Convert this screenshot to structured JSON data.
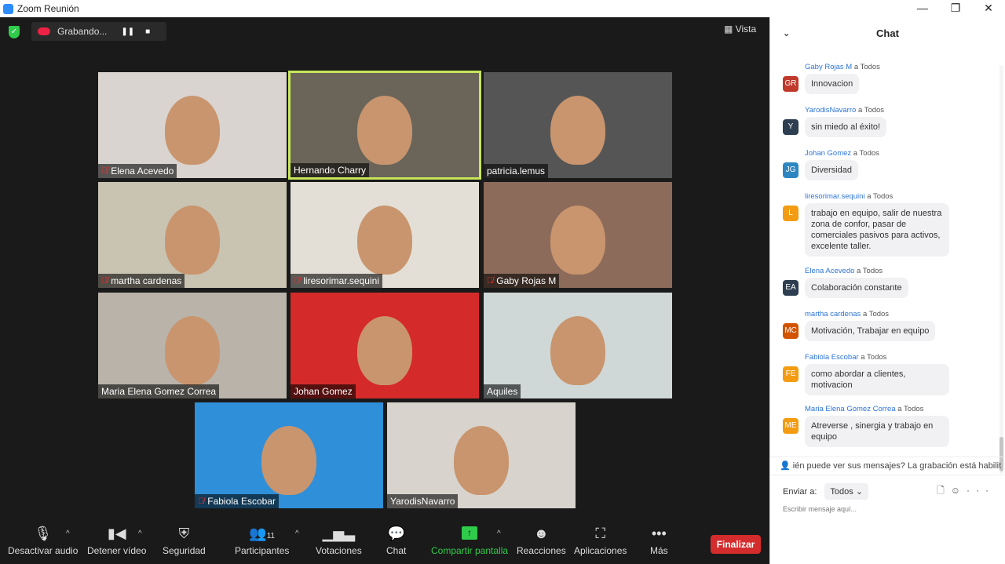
{
  "window": {
    "title": "Zoom Reunión",
    "controls": [
      "—",
      "❐",
      "✕"
    ]
  },
  "recording": {
    "label": "Grabando...",
    "pause": "❚❚",
    "stop": "■"
  },
  "view": {
    "label": "Vista",
    "icon": "grid-icon"
  },
  "tiles": [
    {
      "name": "Elena Acevedo",
      "muted": true,
      "bg": "#d9d4cf"
    },
    {
      "name": "Hernando Charry",
      "muted": false,
      "active": true,
      "bg": "#6b6559"
    },
    {
      "name": "patricia.lemus",
      "muted": false,
      "bg": "#555"
    },
    {
      "name": "martha cardenas",
      "muted": true,
      "bg": "#c9c3b2"
    },
    {
      "name": "liresorimar.sequini",
      "muted": true,
      "bg": "#e3dfd6"
    },
    {
      "name": "Gaby Rojas M",
      "muted": true,
      "bg": "#8c6b5a"
    },
    {
      "name": "Maria Elena Gomez Correa",
      "muted": false,
      "bg": "#b9b3aa"
    },
    {
      "name": "Johan Gomez",
      "muted": false,
      "bg": "#d52a2a"
    },
    {
      "name": "Aquiles",
      "muted": false,
      "bg": "#cfd8d6"
    },
    {
      "name": "Fabiola Escobar",
      "muted": true,
      "bg": "#2f8fd8"
    },
    {
      "name": "YarodisNavarro",
      "muted": false,
      "bg": "#d8d3cd"
    }
  ],
  "toolbar": {
    "audio": "Desactivar audio",
    "video": "Detener vídeo",
    "security": "Seguridad",
    "participants": "Participantes",
    "participants_count": "11",
    "polls": "Votaciones",
    "chat": "Chat",
    "share": "Compartir pantalla",
    "reactions": "Reacciones",
    "apps": "Aplicaciones",
    "more": "Más",
    "end": "Finalizar"
  },
  "chat": {
    "title": "Chat",
    "to": "a Todos",
    "messages": [
      {
        "from": "Gaby Rojas M",
        "initials": "GR",
        "color": "#c0392b",
        "text": "Innovacion"
      },
      {
        "from": "YarodisNavarro",
        "initials": "Y",
        "color": "#2c3e50",
        "text": "sin miedo al éxito!"
      },
      {
        "from": "Johan Gomez",
        "initials": "JG",
        "color": "#2e86c1",
        "text": "Diversidad"
      },
      {
        "from": "liresorimar.sequini",
        "initials": "L",
        "color": "#f39c12",
        "text": "trabajo en equipo, salir de nuestra zona de confor, pasar de comerciales pasivos para activos, excelente taller."
      },
      {
        "from": "Elena Acevedo",
        "initials": "EA",
        "color": "#2c3e50",
        "text": "Colaboración constante"
      },
      {
        "from": "martha cardenas",
        "initials": "MC",
        "color": "#d35400",
        "text": "Motivación, Trabajar en equipo"
      },
      {
        "from": "Fabiola Escobar",
        "initials": "FE",
        "color": "#f39c12",
        "text": "como abordar a clientes, motivacion"
      },
      {
        "from": "Maria Elena Gomez Correa",
        "initials": "ME",
        "color": "#f39c12",
        "text": "Atreverse  , sinergia y trabajo en equipo"
      }
    ],
    "notice": "ién puede ver sus mensajes? La grabación está habilit",
    "send_to_label": "Enviar a:",
    "send_to_value": "Todos",
    "placeholder": "Escribir mensaje aquí..."
  }
}
